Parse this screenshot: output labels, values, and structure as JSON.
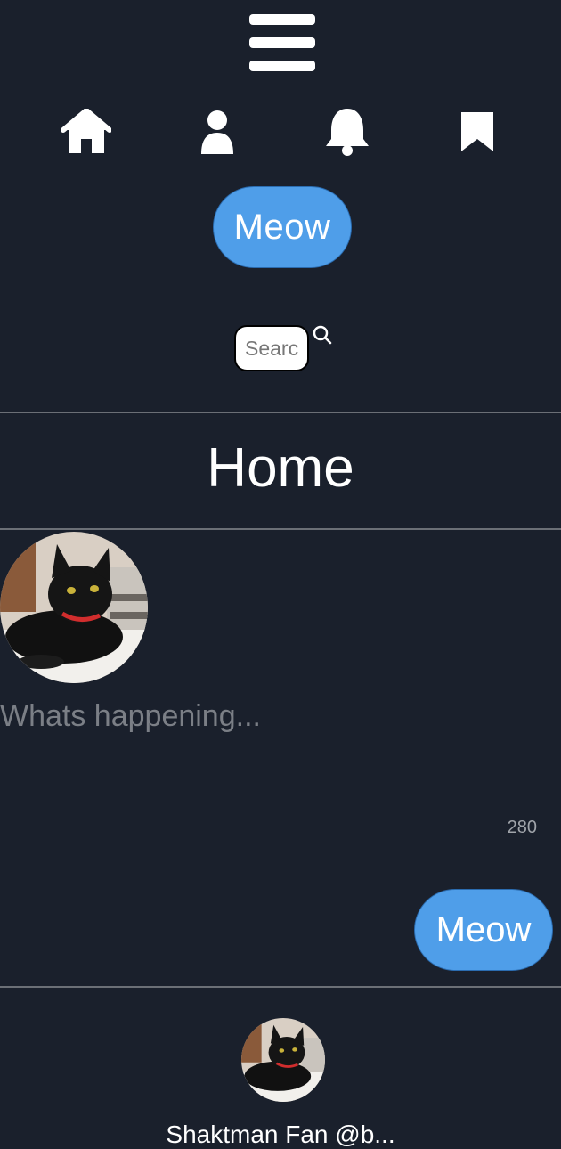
{
  "nav": {
    "icons": [
      "home-icon",
      "user-icon",
      "bell-icon",
      "bookmark-icon"
    ],
    "menu_icon": "hamburger-icon"
  },
  "buttons": {
    "meow_top": "Meow",
    "meow_post": "Meow"
  },
  "search": {
    "placeholder": "Search"
  },
  "header": {
    "title": "Home"
  },
  "composer": {
    "placeholder": "Whats happening...",
    "char_count": "280"
  },
  "feed": {
    "first_item_name": "Shaktman Fan @b..."
  },
  "colors": {
    "background": "#1a202c",
    "accent": "#4f9ee9",
    "divider": "#6b6f76",
    "placeholder_text": "#7b7f86"
  }
}
